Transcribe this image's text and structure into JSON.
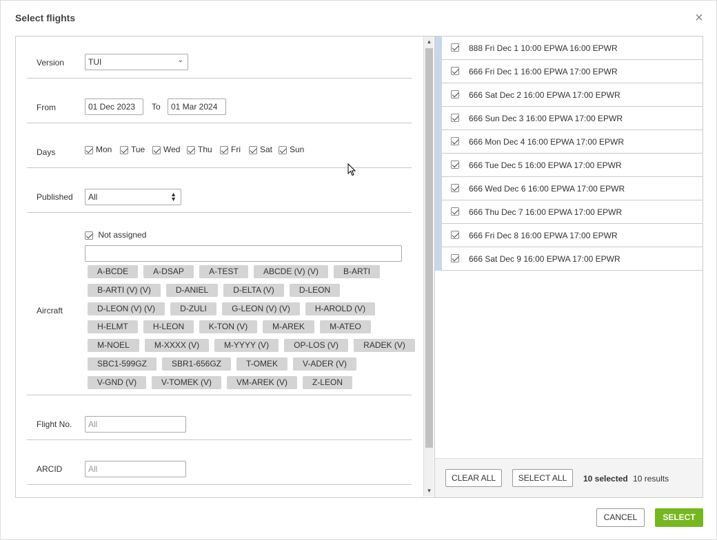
{
  "modal": {
    "title": "Select flights",
    "close_icon": "close-icon"
  },
  "filters": {
    "version": {
      "label": "Version",
      "value": "TUI"
    },
    "from": {
      "label": "From",
      "value": "01 Dec 2023"
    },
    "to": {
      "label": "To",
      "value": "01 Mar 2024"
    },
    "days": {
      "label": "Days",
      "items": [
        {
          "label": "Mon",
          "checked": true
        },
        {
          "label": "Tue",
          "checked": true
        },
        {
          "label": "Wed",
          "checked": true
        },
        {
          "label": "Thu",
          "checked": true
        },
        {
          "label": "Fri",
          "checked": true
        },
        {
          "label": "Sat",
          "checked": true
        },
        {
          "label": "Sun",
          "checked": true
        }
      ]
    },
    "published": {
      "label": "Published",
      "value": "All"
    },
    "aircraft": {
      "label": "Aircraft",
      "not_assigned": {
        "label": "Not assigned",
        "checked": true
      },
      "search_value": "",
      "chips": [
        [
          "A-BCDE",
          "A-DSAP",
          "A-TEST",
          "ABCDE (V) (V)",
          "B-ARTI"
        ],
        [
          "B-ARTI (V) (V)",
          "D-ANIEL",
          "D-ELTA (V)",
          "D-LEON"
        ],
        [
          "D-LEON (V) (V)",
          "D-ZULI",
          "G-LEON (V) (V)",
          "H-AROLD (V)"
        ],
        [
          "H-ELMT",
          "H-LEON",
          "K-TON (V)",
          "M-AREK",
          "M-ATEO"
        ],
        [
          "M-NOEL",
          "M-XXXX (V)",
          "M-YYYY (V)",
          "OP-LOS (V)",
          "RADEK (V)"
        ],
        [
          "SBC1-599GZ",
          "SBR1-656GZ",
          "T-OMEK",
          "V-ADER (V)"
        ],
        [
          "V-GND (V)",
          "V-TOMEK (V)",
          "VM-AREK (V)",
          "Z-LEON"
        ]
      ]
    },
    "flight_no": {
      "label": "Flight No.",
      "placeholder": "All"
    },
    "arcid": {
      "label": "ARCID",
      "placeholder": "All"
    }
  },
  "flights": [
    "888 Fri Dec 1 10:00 EPWA 16:00 EPWR",
    "666 Fri Dec 1 16:00 EPWA 17:00 EPWR",
    "666 Sat Dec 2 16:00 EPWA 17:00 EPWR",
    "666 Sun Dec 3 16:00 EPWA 17:00 EPWR",
    "666 Mon Dec 4 16:00 EPWA 17:00 EPWR",
    "666 Tue Dec 5 16:00 EPWA 17:00 EPWR",
    "666 Wed Dec 6 16:00 EPWA 17:00 EPWR",
    "666 Thu Dec 7 16:00 EPWA 17:00 EPWR",
    "666 Fri Dec 8 16:00 EPWA 17:00 EPWR",
    "666 Sat Dec 9 16:00 EPWA 17:00 EPWR"
  ],
  "results": {
    "clear_all": "CLEAR ALL",
    "select_all": "SELECT ALL",
    "selected": "10 selected",
    "total": "10 results"
  },
  "footer": {
    "cancel": "CANCEL",
    "select": "SELECT"
  },
  "colors": {
    "accent_green": "#74b81c",
    "row_stripe": "#c9d7e8"
  }
}
